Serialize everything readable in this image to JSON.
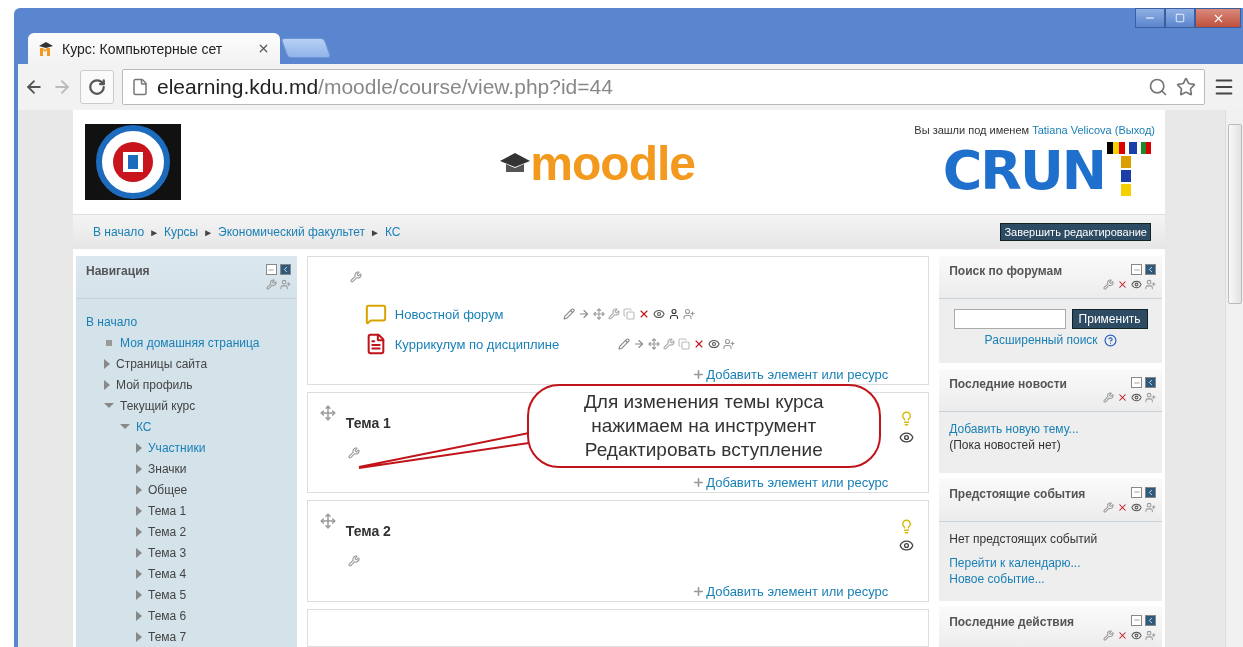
{
  "browser": {
    "tab_title": "Курс: Компьютерные сет",
    "url_host": "elearning.kdu.md",
    "url_path": "/moodle/course/view.php?id=44"
  },
  "header": {
    "logo_text": "moodle",
    "login_prefix": "Вы зашли под именем",
    "user_name": "Tatiana Velicova",
    "logout": "(Выход)",
    "partner_logo": "CRUN"
  },
  "breadcrumb": {
    "separator": "►",
    "items": [
      "В начало",
      "Курсы",
      "Экономический факультет",
      "КС"
    ]
  },
  "edit_button": "Завершить редактирование",
  "navigation": {
    "title": "Навигация",
    "items": [
      {
        "label": "В начало",
        "kind": "root",
        "link": true,
        "children": [
          {
            "label": "Моя домашняя страница",
            "kind": "leaf",
            "link": true
          },
          {
            "label": "Страницы сайта",
            "kind": "branch",
            "link": false,
            "expanded": false
          },
          {
            "label": "Мой профиль",
            "kind": "branch",
            "link": false,
            "expanded": false
          },
          {
            "label": "Текущий курс",
            "kind": "branch",
            "link": false,
            "expanded": true,
            "children": [
              {
                "label": "КС",
                "kind": "branch",
                "link": true,
                "expanded": true,
                "children": [
                  {
                    "label": "Участники",
                    "kind": "branch",
                    "link": true,
                    "expanded": false
                  },
                  {
                    "label": "Значки",
                    "kind": "branch",
                    "link": false,
                    "expanded": false
                  },
                  {
                    "label": "Общее",
                    "kind": "branch",
                    "link": false,
                    "expanded": false
                  },
                  {
                    "label": "Тема 1",
                    "kind": "branch",
                    "link": false,
                    "expanded": false
                  },
                  {
                    "label": "Тема 2",
                    "kind": "branch",
                    "link": false,
                    "expanded": false
                  },
                  {
                    "label": "Тема 3",
                    "kind": "branch",
                    "link": false,
                    "expanded": false
                  },
                  {
                    "label": "Тема 4",
                    "kind": "branch",
                    "link": false,
                    "expanded": false
                  },
                  {
                    "label": "Тема 5",
                    "kind": "branch",
                    "link": false,
                    "expanded": false
                  },
                  {
                    "label": "Тема 6",
                    "kind": "branch",
                    "link": false,
                    "expanded": false
                  },
                  {
                    "label": "Тема 7",
                    "kind": "branch",
                    "link": false,
                    "expanded": false
                  }
                ]
              }
            ]
          }
        ]
      }
    ]
  },
  "sections": [
    {
      "kind": "general",
      "activities": [
        {
          "kind": "forum",
          "name": "Новостной форум"
        },
        {
          "kind": "pdf",
          "name": "Куррикулум по дисциплине"
        }
      ],
      "add": "Добавить элемент или ресурс"
    },
    {
      "kind": "topic",
      "title": "Тема 1",
      "add": "Добавить элемент или ресурс"
    },
    {
      "kind": "topic",
      "title": "Тема 2",
      "add": "Добавить элемент или ресурс"
    },
    {
      "kind": "cut"
    }
  ],
  "callout": {
    "lines": [
      "Для изменения темы курса",
      "нажимаем на инструмент",
      "Редактировать вступление"
    ]
  },
  "blocks": [
    {
      "kind": "search",
      "title": "Поиск по форумам",
      "button": "Применить",
      "link": "Расширенный поиск"
    },
    {
      "kind": "news",
      "title": "Последние новости",
      "link": "Добавить новую тему...",
      "note": "(Пока новостей нет)"
    },
    {
      "kind": "events",
      "title": "Предстоящие события",
      "note": "Нет предстоящих событий",
      "links": [
        "Перейти к календарю...",
        "Новое событие..."
      ]
    },
    {
      "kind": "plain",
      "title": "Последние действия"
    }
  ]
}
